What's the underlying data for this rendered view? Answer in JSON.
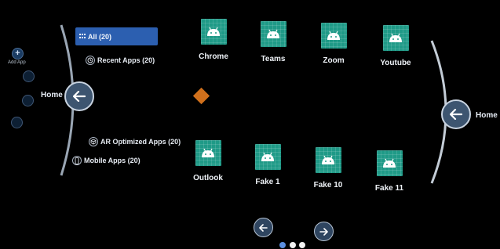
{
  "sidebar": {
    "add_app_label": "Add App",
    "home_label": "Home"
  },
  "categories": {
    "all": "All (20)",
    "recent": "Recent Apps (20)",
    "ar": "AR Optimized Apps (20)",
    "mobile": "Mobile Apps (20)"
  },
  "apps_row1": [
    {
      "label": "Chrome",
      "icon": "android-icon"
    },
    {
      "label": "Teams",
      "icon": "android-icon"
    },
    {
      "label": "Zoom",
      "icon": "android-icon"
    },
    {
      "label": "Youtube",
      "icon": "android-icon"
    }
  ],
  "apps_row2": [
    {
      "label": "Outlook",
      "icon": "android-icon"
    },
    {
      "label": "Fake 1",
      "icon": "android-icon"
    },
    {
      "label": "Fake 10",
      "icon": "android-icon"
    },
    {
      "label": "Fake 11",
      "icon": "android-icon"
    }
  ],
  "right_home_label": "Home",
  "pagination": {
    "total_pages": 3,
    "current_page": 1
  },
  "colors": {
    "background": "#000000",
    "tile": "#1f9a87",
    "selected_category": "#2c5fb0",
    "diamond": "#d0701c"
  }
}
